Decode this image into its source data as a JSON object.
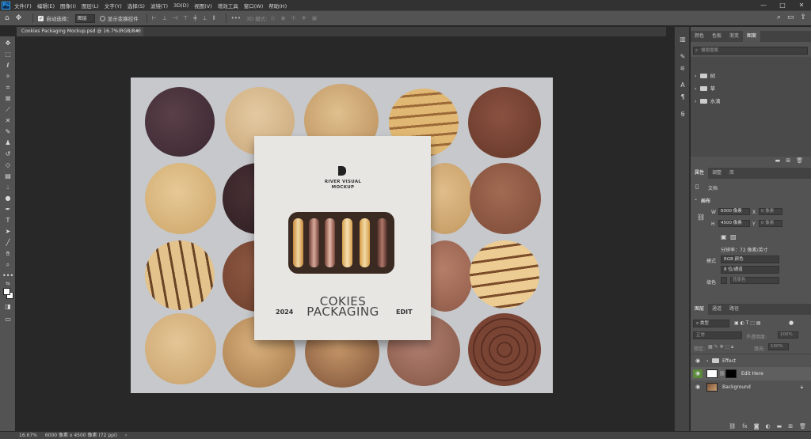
{
  "app": {
    "logo": "Ps"
  },
  "menu": [
    "文件(F)",
    "编辑(E)",
    "图像(I)",
    "图层(L)",
    "文字(Y)",
    "选择(S)",
    "滤镜(T)",
    "3D(D)",
    "视图(V)",
    "增效工具",
    "窗口(W)",
    "帮助(H)"
  ],
  "window_controls": {
    "minimize": "—",
    "maximize": "□",
    "close": "✕"
  },
  "options": {
    "auto_select_label": "自动选择：",
    "auto_select_value": "图层",
    "show_transform_label": "显示变换控件",
    "mode3d_label": "3D 模式:"
  },
  "document": {
    "tab_title": "Cookies Packaging Mockup.psd @ 16.7%(RGB/8#)",
    "close": "×"
  },
  "mockup": {
    "brand_line1": "RIVER VISUAL",
    "brand_line2": "MOCKUP",
    "year": "2024",
    "title_line1": "COKIES",
    "title_line2": "PACKAGING",
    "edit": "EDIT"
  },
  "status": {
    "zoom": "16.67%",
    "doc_info": "6000 像素 x 4500 像素 (72 ppi)",
    "arrow": "›"
  },
  "panel_top": {
    "tabs": [
      "颜色",
      "色板",
      "渐变",
      "图案"
    ],
    "active_tab": "图案",
    "search_placeholder": "搜索图案",
    "folders": [
      "树",
      "草",
      "水滴"
    ]
  },
  "properties": {
    "tabs": [
      "属性",
      "调整",
      "库"
    ],
    "active_tab": "属性",
    "doc_label": "文档",
    "canvas_label": "画布",
    "w_label": "W",
    "w_value": "6000 像素",
    "x_label": "X",
    "x_placeholder": "0 像素",
    "h_label": "H",
    "h_value": "4500 像素",
    "y_label": "Y",
    "y_placeholder": "0 像素",
    "resolution": "分辨率：72 像素/英寸",
    "mode_label": "模式",
    "mode_value": "RGB 颜色",
    "depth_value": "8 位/通道",
    "fill_label": "填色",
    "fill_value": "背景色"
  },
  "layers": {
    "tabs": [
      "图层",
      "通道",
      "路径"
    ],
    "active_tab": "图层",
    "filter_label": "类型",
    "blend_mode": "正常",
    "opacity_label": "不透明度:",
    "opacity_value": "100%",
    "lock_label": "锁定:",
    "fill_label": "填充:",
    "fill_value": "100%",
    "items": [
      {
        "name": "Effect",
        "type": "group"
      },
      {
        "name": "Edit Here",
        "type": "smart"
      },
      {
        "name": "Background",
        "type": "background"
      }
    ]
  },
  "colors": {
    "accent": "#31a8ff",
    "eye_on": "#5a8a3a"
  }
}
